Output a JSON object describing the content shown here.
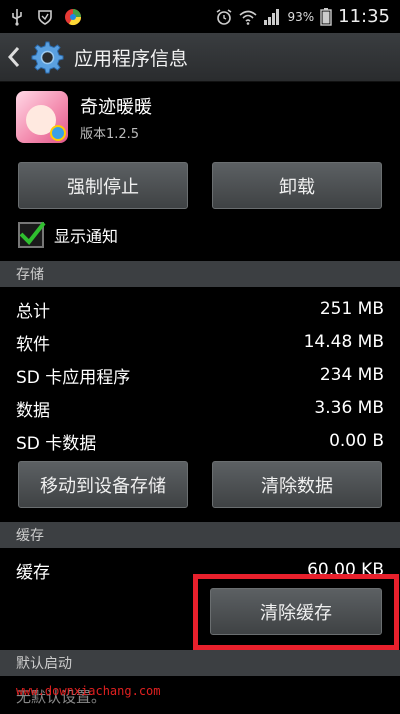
{
  "status_bar": {
    "battery": "93%",
    "time": "11:35"
  },
  "action_bar": {
    "title": "应用程序信息"
  },
  "app": {
    "name": "奇迹暖暖",
    "version": "版本1.2.5"
  },
  "buttons": {
    "force_stop": "强制停止",
    "uninstall": "卸载",
    "move_to_storage": "移动到设备存储",
    "clear_data": "清除数据",
    "clear_cache": "清除缓存"
  },
  "notification": {
    "label": "显示通知",
    "checked": true
  },
  "storage": {
    "header": "存储",
    "rows": [
      {
        "label": "总计",
        "value": "251 MB"
      },
      {
        "label": "软件",
        "value": "14.48 MB"
      },
      {
        "label": "SD 卡应用程序",
        "value": "234 MB"
      },
      {
        "label": "数据",
        "value": "3.36 MB"
      },
      {
        "label": "SD 卡数据",
        "value": "0.00 B"
      }
    ]
  },
  "cache": {
    "header": "缓存",
    "label": "缓存",
    "value": "60.00 KB"
  },
  "default_launch": {
    "header": "默认启动",
    "text": "无默认设置。"
  },
  "watermark": "www.downxiachang.com",
  "colors": {
    "highlight": "#e8202c",
    "check": "#2fbf2f"
  }
}
